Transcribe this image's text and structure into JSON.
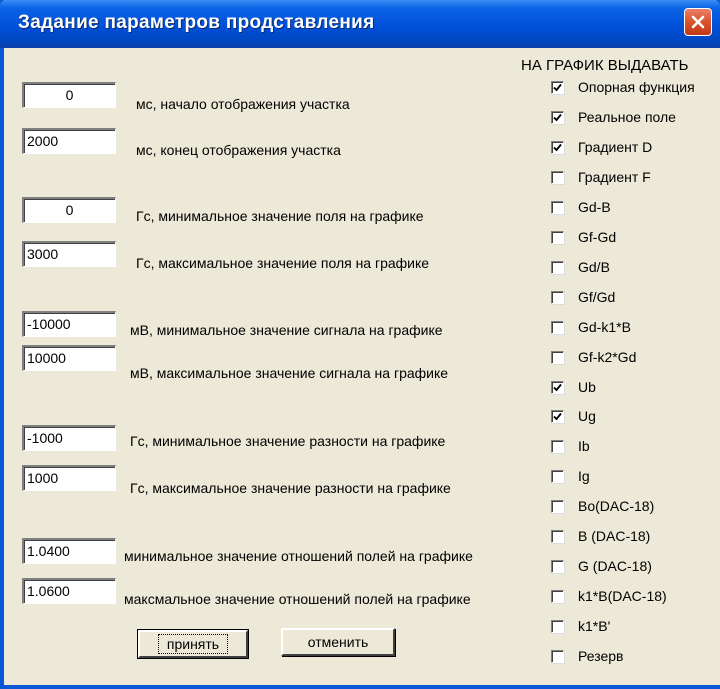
{
  "window": {
    "title": "Задание параметров продставления"
  },
  "fields": [
    {
      "value": "0",
      "label": "мс, начало отображения участка"
    },
    {
      "value": "2000",
      "label": "мс, конец отображения участка"
    },
    {
      "value": "0",
      "label": "Гс, минимальное значение поля на графике"
    },
    {
      "value": "3000",
      "label": "Гс, максимальное значение поля на графике"
    },
    {
      "value": "-10000",
      "label": "мВ, минимальное значение сигнала на графике"
    },
    {
      "value": "10000",
      "label": "мВ, максимальное значение сигнала на графике"
    },
    {
      "value": "-1000",
      "label": "Гс, минимальное значение разности на графике"
    },
    {
      "value": "1000",
      "label": "Гс, максимальное значение разности на графике"
    },
    {
      "value": "1.0400",
      "label": "минимальное значение отношений полей на графике"
    },
    {
      "value": "1.0600",
      "label": "максмальное значение отношений полей на графике"
    }
  ],
  "output_header": "НА ГРАФИК ВЫДАВАТЬ",
  "checkboxes": [
    {
      "label": "Опорная функция",
      "checked": true
    },
    {
      "label": "Реальное поле",
      "checked": true
    },
    {
      "label": "Градиент D",
      "checked": true
    },
    {
      "label": "Градиент F",
      "checked": false
    },
    {
      "label": "Gd-B",
      "checked": false
    },
    {
      "label": "Gf-Gd",
      "checked": false
    },
    {
      "label": "Gd/B",
      "checked": false
    },
    {
      "label": "Gf/Gd",
      "checked": false
    },
    {
      "label": "Gd-k1*B",
      "checked": false
    },
    {
      "label": "Gf-k2*Gd",
      "checked": false
    },
    {
      "label": "Ub",
      "checked": true
    },
    {
      "label": "Ug",
      "checked": true
    },
    {
      "label": "Ib",
      "checked": false
    },
    {
      "label": "Ig",
      "checked": false
    },
    {
      "label": "Bo(DAC-18)",
      "checked": false
    },
    {
      "label": "B (DAC-18)",
      "checked": false
    },
    {
      "label": "G (DAC-18)",
      "checked": false
    },
    {
      "label": "k1*B(DAC-18)",
      "checked": false
    },
    {
      "label": "k1*B'",
      "checked": false
    },
    {
      "label": "Резерв",
      "checked": false
    }
  ],
  "buttons": {
    "accept": "принять",
    "cancel": "отменить"
  },
  "icons": {
    "close": "close-icon",
    "check": "checkmark-icon"
  },
  "colors": {
    "title_bar": "#0050d8",
    "close_button": "#d9532b",
    "dialog_bg": "#ece9d8"
  }
}
